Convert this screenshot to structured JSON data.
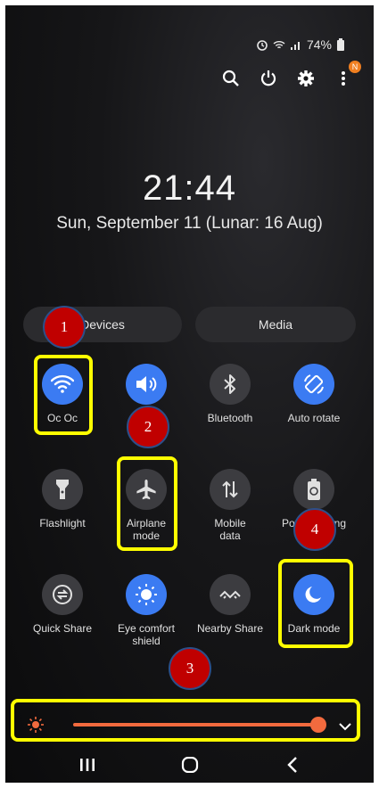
{
  "status": {
    "battery": "74%"
  },
  "notification_badge": "N",
  "clock": {
    "time": "21:44",
    "date": "Sun, September 11 (Lunar: 16 Aug)"
  },
  "buttons": {
    "devices": "Devices",
    "media": "Media"
  },
  "tiles": {
    "wifi": {
      "label": "Oc Oc",
      "on": true
    },
    "sound": {
      "label": "",
      "on": true
    },
    "bluetooth": {
      "label": "Bluetooth",
      "on": false
    },
    "auto_rotate": {
      "label": "Auto rotate",
      "on": true
    },
    "flashlight": {
      "label": "Flashlight",
      "on": false
    },
    "airplane": {
      "label": "Airplane\nmode",
      "on": false
    },
    "mobile_data": {
      "label": "Mobile\ndata",
      "on": false
    },
    "power_saving": {
      "label": "Power saving",
      "on": false
    },
    "quick_share": {
      "label": "Quick Share",
      "on": false
    },
    "eye_comfort": {
      "label": "Eye comfort\nshield",
      "on": true
    },
    "nearby_share": {
      "label": "Nearby Share",
      "on": false
    },
    "dark_mode": {
      "label": "Dark mode",
      "on": true
    }
  },
  "brightness": {
    "level": 0.95,
    "color": "#f26a3e"
  },
  "callouts": [
    "1",
    "2",
    "3",
    "4"
  ],
  "colors": {
    "accent": "#3b7bf2",
    "highlight": "#ffff00",
    "callout": "#c00000"
  }
}
